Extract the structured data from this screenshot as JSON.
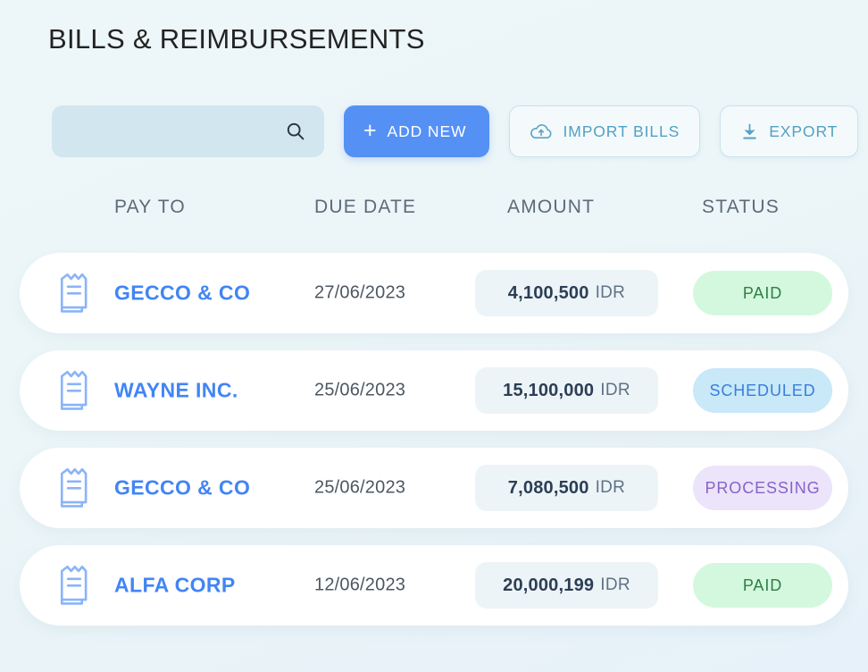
{
  "page": {
    "title": "BILLS & REIMBURSEMENTS",
    "background_color": "#edf6f8"
  },
  "toolbar": {
    "search": {
      "value": "",
      "placeholder": "",
      "icon": "search-icon"
    },
    "add_new": {
      "label": "ADD NEW",
      "plus": "+",
      "color": "#5590f5"
    },
    "import_bills": {
      "label": "IMPORT BILLS",
      "icon": "cloud-upload-icon"
    },
    "export": {
      "label": "EXPORT",
      "icon": "download-icon"
    }
  },
  "table": {
    "columns": [
      "PAY TO",
      "DUE DATE",
      "AMOUNT",
      "STATUS"
    ],
    "rows": [
      {
        "icon": "receipt-icon",
        "pay_to": "GECCO & CO",
        "due_date": "27/06/2023",
        "amount": "4,100,500",
        "currency": "IDR",
        "status": "PAID",
        "status_key": "paid"
      },
      {
        "icon": "receipt-icon",
        "pay_to": "WAYNE INC.",
        "due_date": "25/06/2023",
        "amount": "15,100,000",
        "currency": "IDR",
        "status": "SCHEDULED",
        "status_key": "scheduled"
      },
      {
        "icon": "receipt-icon",
        "pay_to": "GECCO & CO",
        "due_date": "25/06/2023",
        "amount": "7,080,500",
        "currency": "IDR",
        "status": "PROCESSING",
        "status_key": "processing"
      },
      {
        "icon": "receipt-icon",
        "pay_to": "ALFA CORP",
        "due_date": "12/06/2023",
        "amount": "20,000,199",
        "currency": "IDR",
        "status": "PAID",
        "status_key": "paid"
      }
    ]
  },
  "status_colors": {
    "paid": {
      "bg": "#d4f8de",
      "fg": "#2f7e47"
    },
    "scheduled": {
      "bg": "#c9e8f8",
      "fg": "#3880db"
    },
    "processing": {
      "bg": "#ebe4fa",
      "fg": "#8862c6"
    }
  }
}
